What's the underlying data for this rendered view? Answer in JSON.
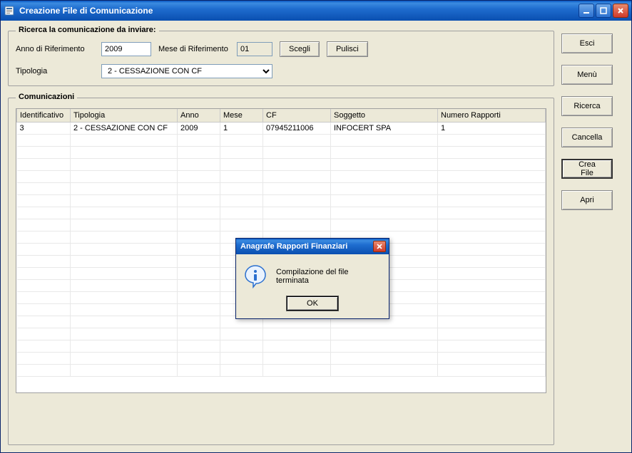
{
  "window": {
    "title": "Creazione File di Comunicazione"
  },
  "search": {
    "legend": "Ricerca la comunicazione da inviare:",
    "anno_label": "Anno di Riferimento",
    "anno_value": "2009",
    "mese_label": "Mese di Riferimento",
    "mese_value": "01",
    "scegli_label": "Scegli",
    "pulisci_label": "Pulisci",
    "tipologia_label": "Tipologia",
    "tipologia_value": "2 - CESSAZIONE CON CF"
  },
  "grid": {
    "legend": "Comunicazioni",
    "columns": [
      "Identificativo",
      "Tipologia",
      "Anno",
      "Mese",
      "CF",
      "Soggetto",
      "Numero Rapporti"
    ],
    "rows": [
      {
        "id": "3",
        "tipologia": "2 - CESSAZIONE CON CF",
        "anno": "2009",
        "mese": "1",
        "cf": "07945211006",
        "soggetto": "INFOCERT SPA",
        "num": "1"
      }
    ]
  },
  "sidebar": {
    "esci": "Esci",
    "menu": "Menù",
    "ricerca": "Ricerca",
    "cancella": "Cancella",
    "crea_file": "Crea File",
    "apri": "Apri"
  },
  "dialog": {
    "title": "Anagrafe Rapporti Finanziari",
    "message": "Compilazione del file terminata",
    "ok": "OK"
  }
}
